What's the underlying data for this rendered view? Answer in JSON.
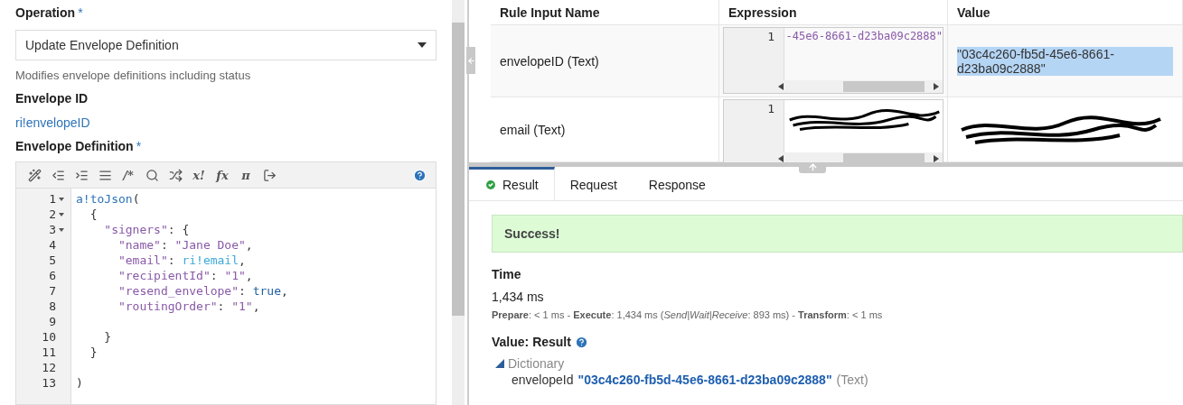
{
  "form": {
    "operation": {
      "label": "Operation",
      "required_mark": "*",
      "value": "Update Envelope Definition",
      "help": "Modifies envelope definitions including status"
    },
    "envelope_id": {
      "label": "Envelope ID",
      "value": "ri!envelopeID"
    },
    "envelope_definition": {
      "label": "Envelope Definition",
      "required_mark": "*",
      "toolbar": [
        {
          "kind": "wand"
        },
        {
          "kind": "outdent"
        },
        {
          "kind": "indent"
        },
        {
          "kind": "lines"
        },
        {
          "kind": "glyph",
          "text": "/*"
        },
        {
          "kind": "search"
        },
        {
          "kind": "shuffle"
        },
        {
          "kind": "glyph",
          "text": "x!"
        },
        {
          "kind": "glyph",
          "text": "fx"
        },
        {
          "kind": "glyph",
          "text": "π"
        },
        {
          "kind": "export"
        }
      ],
      "lines": [
        {
          "number": "1",
          "fold": true,
          "tokens": [
            {
              "text": "a!toJson",
              "kind": "function"
            },
            {
              "text": "(",
              "kind": "plain"
            }
          ]
        },
        {
          "number": "2",
          "fold": true,
          "tokens": [
            {
              "text": "  {",
              "kind": "plain"
            }
          ]
        },
        {
          "number": "3",
          "fold": true,
          "tokens": [
            {
              "text": "    \"signers\"",
              "kind": "string"
            },
            {
              "text": ": {",
              "kind": "plain"
            }
          ]
        },
        {
          "number": "4",
          "fold": false,
          "tokens": [
            {
              "text": "      \"name\"",
              "kind": "string"
            },
            {
              "text": ": ",
              "kind": "plain"
            },
            {
              "text": "\"Jane Doe\"",
              "kind": "string"
            },
            {
              "text": ",",
              "kind": "plain"
            }
          ]
        },
        {
          "number": "5",
          "fold": false,
          "tokens": [
            {
              "text": "      \"email\"",
              "kind": "string"
            },
            {
              "text": ": ",
              "kind": "plain"
            },
            {
              "text": "ri!email",
              "kind": "rule"
            },
            {
              "text": ",",
              "kind": "plain"
            }
          ]
        },
        {
          "number": "6",
          "fold": false,
          "tokens": [
            {
              "text": "      \"recipientId\"",
              "kind": "string"
            },
            {
              "text": ": ",
              "kind": "plain"
            },
            {
              "text": "\"1\"",
              "kind": "string"
            },
            {
              "text": ",",
              "kind": "plain"
            }
          ]
        },
        {
          "number": "7",
          "fold": false,
          "tokens": [
            {
              "text": "      \"resend_envelope\"",
              "kind": "string"
            },
            {
              "text": ": ",
              "kind": "plain"
            },
            {
              "text": "true",
              "kind": "keyword"
            },
            {
              "text": ",",
              "kind": "plain"
            }
          ]
        },
        {
          "number": "8",
          "fold": false,
          "tokens": [
            {
              "text": "      \"routingOrder\"",
              "kind": "string"
            },
            {
              "text": ": ",
              "kind": "plain"
            },
            {
              "text": "\"1\"",
              "kind": "string"
            },
            {
              "text": ",",
              "kind": "plain"
            }
          ]
        },
        {
          "number": "9",
          "fold": false
        },
        {
          "number": "10",
          "fold": false,
          "tokens": [
            {
              "text": "    }",
              "kind": "plain"
            }
          ]
        },
        {
          "number": "11",
          "fold": false,
          "tokens": [
            {
              "text": "  }",
              "kind": "plain"
            }
          ]
        },
        {
          "number": "12",
          "fold": false
        },
        {
          "number": "13",
          "fold": false,
          "tokens": [
            {
              "text": ")",
              "kind": "plain"
            }
          ]
        }
      ]
    }
  },
  "rule_inputs": {
    "columns": [
      "Rule Input Name",
      "Expression",
      "Value"
    ],
    "rows": [
      {
        "name": "envelopeID (Text)",
        "expression": {
          "line": "1",
          "text": "-45e6-8661-d23ba09c2888\"",
          "redacted": false
        },
        "value": {
          "text": "\"03c4c260-fb5d-45e6-8661-d23ba09c2888\"",
          "highlighted": true,
          "redacted": false
        }
      },
      {
        "name": "email (Text)",
        "expression": {
          "line": "1",
          "redacted": true
        },
        "value": {
          "redacted": true
        }
      }
    ]
  },
  "tabs": [
    {
      "label": "Result",
      "selected": true
    },
    {
      "label": "Request",
      "selected": false
    },
    {
      "label": "Response",
      "selected": false
    }
  ],
  "result": {
    "status": "Success!",
    "time_label": "Time",
    "time": "1,434 ms",
    "breakdown": "**Prepare**: < 1 ms - **Execute**: 1,434 ms (*Send|Wait|Receive*: 893 ms) - **Transform**: < 1 ms",
    "value_label": "Value: Result",
    "tree": [
      {
        "label": "Dictionary",
        "expanded": true,
        "children": [
          {
            "key": "envelopeId",
            "value": "\"03c4c260-fb5d-45e6-8661-d23ba09c2888\"",
            "type": "(Text)"
          }
        ]
      }
    ]
  }
}
